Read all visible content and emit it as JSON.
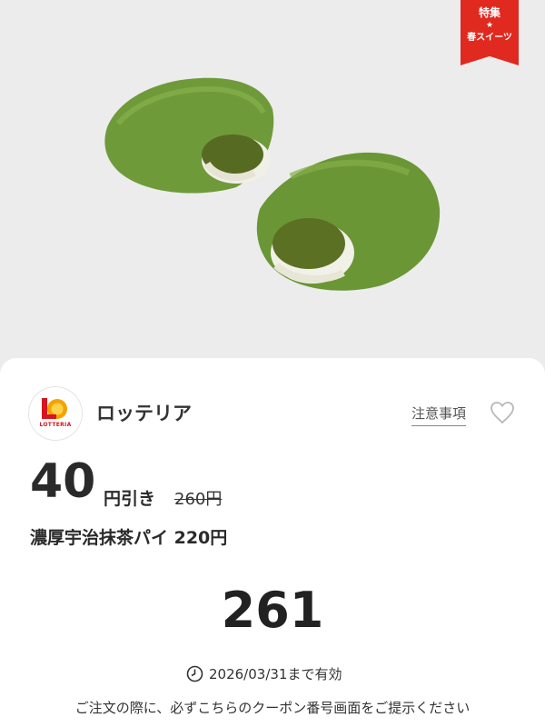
{
  "hero": {
    "badge_top": "特集",
    "badge_star": "★",
    "badge_bottom": "春スイーツ"
  },
  "brand": {
    "logo_text": "LOTTERIA",
    "name": "ロッテリア"
  },
  "actions": {
    "notice_label": "注意事項",
    "favorite_icon": "heart-icon"
  },
  "offer": {
    "discount_amount": "40",
    "discount_unit": "円引き",
    "original_price": "260円",
    "product_name": "濃厚宇治抹茶パイ 220円"
  },
  "coupon": {
    "code": "261",
    "validity": "2026/03/31まで有効",
    "instructions": "ご注文の際に、必ずこちらのクーポン番号画面をご提示ください"
  },
  "colors": {
    "accent_red": "#e0291f",
    "matcha_green": "#6f9a3a",
    "cream": "#f1f0e6"
  }
}
